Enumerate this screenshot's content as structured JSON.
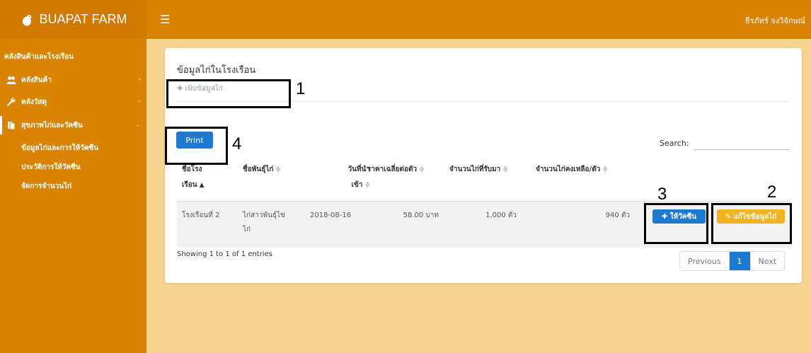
{
  "header": {
    "brand": "BUAPAT FARM",
    "user": "ธีรภัทร์ จงวิจักษณ์"
  },
  "sidebar": {
    "section_title": "คลังสินค้าและโรงเรือน",
    "items": [
      {
        "label": "คลังสินค้า",
        "icon": "users-icon"
      },
      {
        "label": "คลังวัสดุ",
        "icon": "wrench-icon"
      },
      {
        "label": "สุขภาพไก่และวัคซีน",
        "icon": "book-icon"
      }
    ],
    "sub_items": [
      "ข้อมูลไก่และการให้วัคซีน",
      "ประวัติการให้วัคซีน",
      "จัดการจำนวนไก่"
    ]
  },
  "card": {
    "title": "ข้อมูลไก่ในโรงเรือน",
    "add_label": "✚ เพิ่มข้อมูลไก่",
    "print_label": "Print",
    "search_label": "Search:",
    "search_value": ""
  },
  "table": {
    "headers": [
      {
        "l1": "ชื่อโรง",
        "l2": "เรือน",
        "sort": "▲"
      },
      {
        "l1": "ชื่อพันธุ์ไก่",
        "sort": "≑"
      },
      {
        "l1": "วันที่นำ",
        "l2": "เข้า",
        "sort": "≑"
      },
      {
        "l1": "ราคาเฉลี่ยต่อตัว",
        "sort": "≑"
      },
      {
        "l1": "จำนวนไก่ที่รับมา",
        "sort": "≑"
      },
      {
        "l1": "จำนวนไก่คงเหลือ/ตัว",
        "sort": "≑"
      }
    ],
    "rows": [
      {
        "house": "โรงเรือนที่ 2",
        "breed_l1": "ไก่สาวพันธุ์ไข่",
        "breed_l2": "ไก่",
        "date": "2018-08-16",
        "price": "58.00 บาท",
        "received": "1,000 ตัว",
        "remaining": "940 ตัว",
        "vaccine_label": "✚ ให้วัคซีน",
        "edit_label": "✎ แก้ไขข้อมูลไก่"
      }
    ],
    "info": "Showing 1 to 1 of 1 entries",
    "pager": {
      "prev": "Previous",
      "current": "1",
      "next": "Next"
    }
  },
  "annotations": [
    "1",
    "2",
    "3",
    "4"
  ],
  "colors": {
    "topbar": "#d98400",
    "background": "#f6d492",
    "primary": "#1e7ad1",
    "warning": "#f0b322"
  }
}
